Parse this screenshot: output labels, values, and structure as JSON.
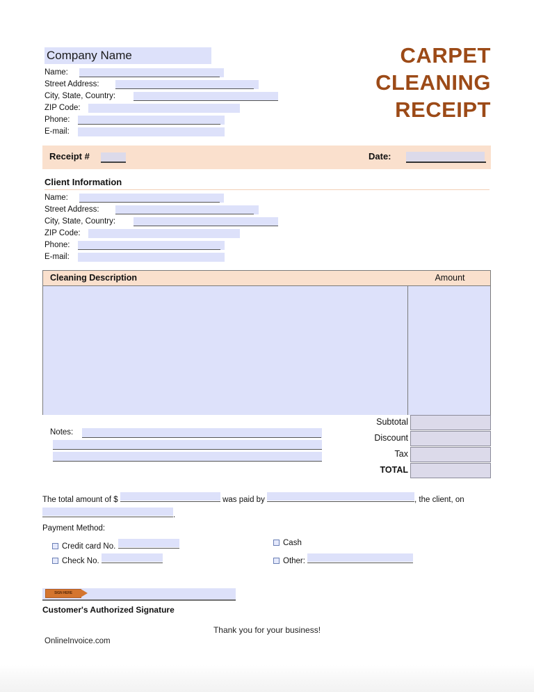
{
  "document": {
    "title_lines": [
      "CARPET",
      "CLEANING",
      "RECEIPT"
    ],
    "title_color": "#9c4a17",
    "accent_peach": "#fae0cd",
    "field_fill": "#dde1fa",
    "total_fill": "#dcdaea"
  },
  "company": {
    "name_placeholder": "Company Name",
    "fields": [
      {
        "label": "Name:",
        "value": ""
      },
      {
        "label": "Street Address:",
        "value": ""
      },
      {
        "label": "City, State, Country:",
        "value": ""
      },
      {
        "label": "ZIP Code:",
        "value": ""
      },
      {
        "label": "Phone:",
        "value": ""
      },
      {
        "label": "E-mail:",
        "value": ""
      }
    ]
  },
  "receipt_bar": {
    "receipt_label": "Receipt #",
    "receipt_value": "",
    "date_label": "Date:",
    "date_value": ""
  },
  "client": {
    "heading": "Client Information",
    "fields": [
      {
        "label": "Name:",
        "value": ""
      },
      {
        "label": "Street Address:",
        "value": ""
      },
      {
        "label": "City, State, Country:",
        "value": ""
      },
      {
        "label": "ZIP Code:",
        "value": ""
      },
      {
        "label": "Phone:",
        "value": ""
      },
      {
        "label": "E-mail:",
        "value": ""
      }
    ]
  },
  "table": {
    "header_description": "Cleaning Description",
    "header_amount": "Amount",
    "description_body": "",
    "amount_body": ""
  },
  "notes": {
    "label": "Notes:",
    "line1": "",
    "line2": "",
    "line3": ""
  },
  "totals": [
    {
      "label": "Subtotal",
      "value": ""
    },
    {
      "label": "Discount",
      "value": ""
    },
    {
      "label": "Tax",
      "value": ""
    },
    {
      "label": "TOTAL",
      "value": ""
    }
  ],
  "paid_statement": {
    "part1": "The total amount of $",
    "amount_value": "",
    "part2": "was paid by",
    "payer_value": "",
    "part3": ", the client, on",
    "date_value": "",
    "part4": "."
  },
  "payment_method": {
    "title": "Payment Method:",
    "options": [
      {
        "label": "Credit card No.",
        "value": "",
        "checked": false
      },
      {
        "label": "Check No.",
        "value": "",
        "checked": false
      },
      {
        "label": "Cash",
        "value": "",
        "checked": false
      },
      {
        "label": "Other:",
        "value": "",
        "checked": false
      }
    ]
  },
  "signature": {
    "tag_text": "SIGN HERE",
    "value": "",
    "caption": "Customer's Authorized Signature"
  },
  "footer": {
    "thanks": "Thank you for your business!",
    "brand": "OnlineInvoice.com"
  }
}
